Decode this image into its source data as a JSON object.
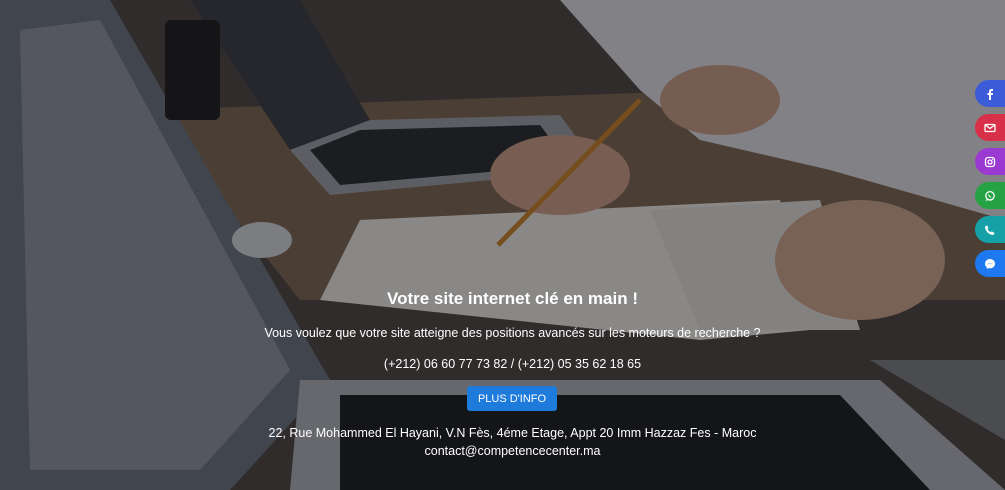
{
  "hero": {
    "title": "Votre site internet clé en main !",
    "subtitle": "Vous voulez que votre site atteigne des positions avancés sur les moteurs de recherche ?",
    "phones": "(+212) 06 60 77 73 82 / (+212) 05 35 62 18 65",
    "cta_label": "PLUS D'INFO",
    "address": "22, Rue Mohammed El Hayani, V.N Fès, 4éme Etage, Appt 20 Imm Hazzaz Fes - Maroc",
    "email": "contact@competencecenter.ma"
  },
  "social": [
    {
      "icon": "facebook-icon",
      "color": "#3b5bd9"
    },
    {
      "icon": "email-icon",
      "color": "#d9304a"
    },
    {
      "icon": "instagram-icon",
      "color": "#9b3ad0"
    },
    {
      "icon": "whatsapp-icon",
      "color": "#25a244"
    },
    {
      "icon": "phone-icon",
      "color": "#16a0a8"
    },
    {
      "icon": "messenger-icon",
      "color": "#1e78f0"
    }
  ],
  "colors": {
    "button": "#1f7bdb",
    "overlay": "rgba(10,10,14,0.42)"
  }
}
